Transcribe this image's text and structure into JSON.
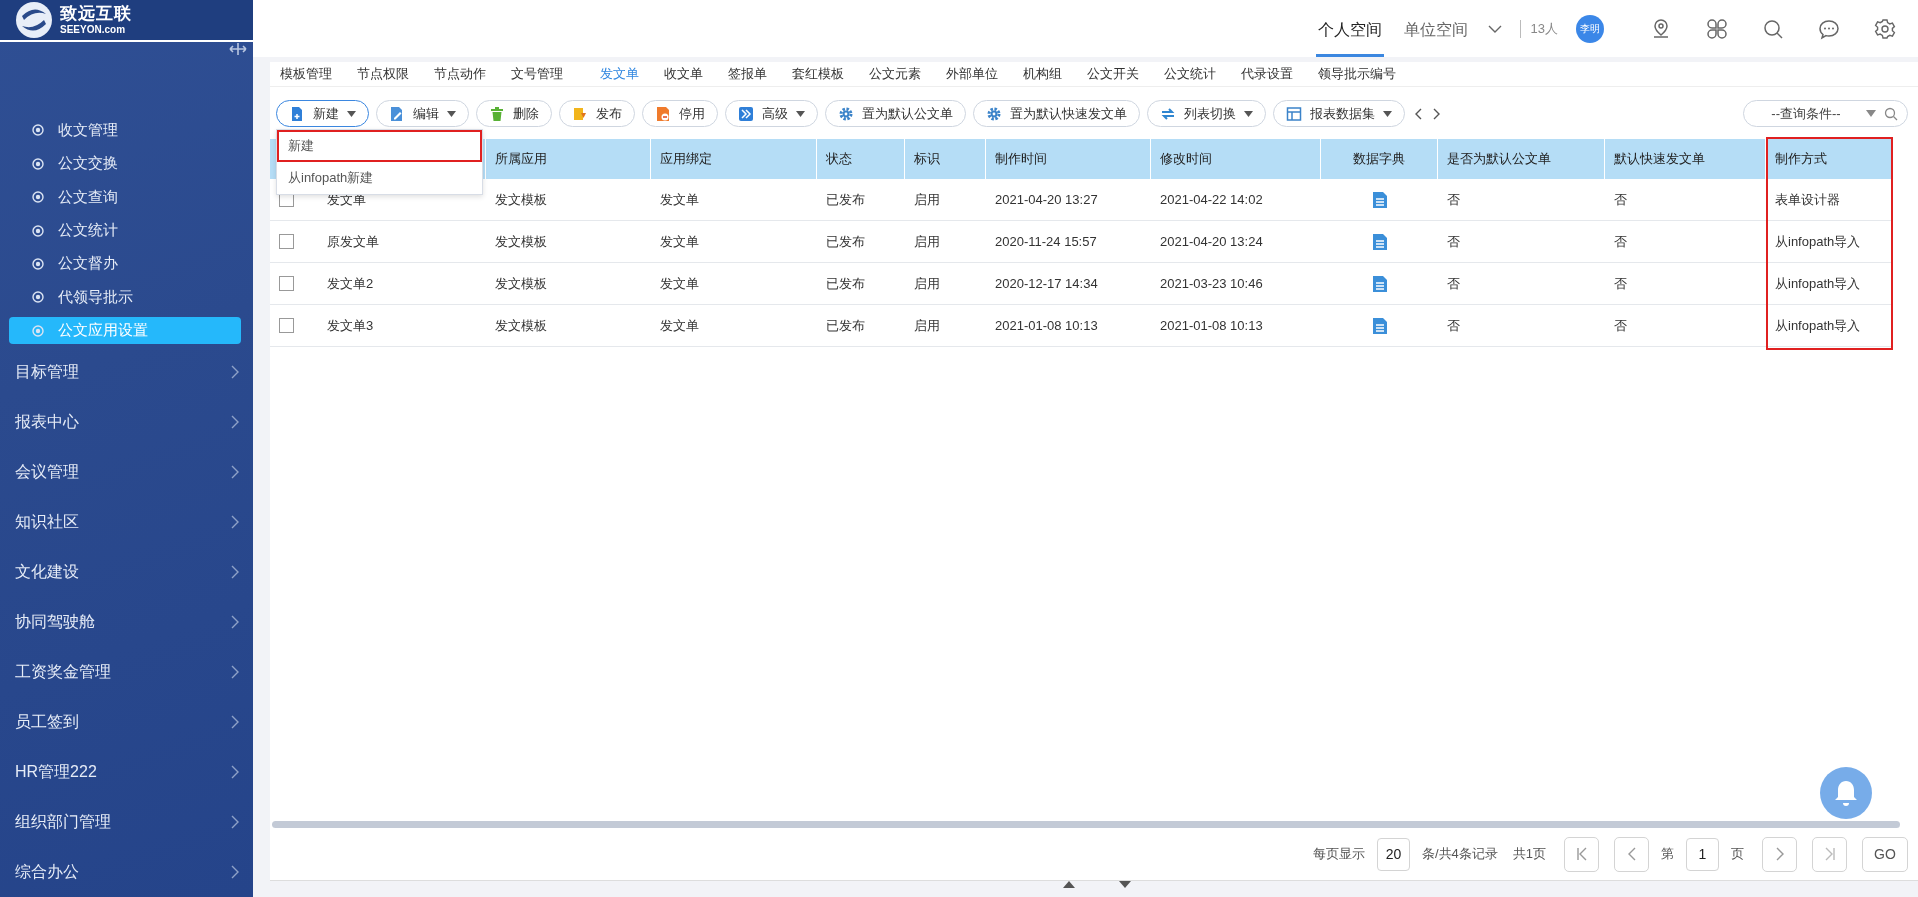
{
  "logo": {
    "name": "致远互联",
    "domain": "SEEYON.com"
  },
  "sidebar": {
    "sub_items": [
      {
        "label": "收文管理",
        "selected": false
      },
      {
        "label": "公文交换",
        "selected": false
      },
      {
        "label": "公文查询",
        "selected": false
      },
      {
        "label": "公文统计",
        "selected": false
      },
      {
        "label": "公文督办",
        "selected": false
      },
      {
        "label": "代领导批示",
        "selected": false
      },
      {
        "label": "公文应用设置",
        "selected": true
      }
    ],
    "items": [
      {
        "label": "目标管理"
      },
      {
        "label": "报表中心"
      },
      {
        "label": "会议管理"
      },
      {
        "label": "知识社区"
      },
      {
        "label": "文化建设"
      },
      {
        "label": "协同驾驶舱"
      },
      {
        "label": "工资奖金管理"
      },
      {
        "label": "员工签到"
      },
      {
        "label": "HR管理222"
      },
      {
        "label": "组织部门管理"
      },
      {
        "label": "综合办公"
      }
    ]
  },
  "top_bar": {
    "spaces": [
      {
        "label": "个人空间",
        "selected": true
      },
      {
        "label": "单位空间",
        "selected": false
      }
    ],
    "online": "13人",
    "avatar": "李明"
  },
  "tabs": [
    {
      "label": "模板管理",
      "selected": false
    },
    {
      "label": "节点权限",
      "selected": false
    },
    {
      "label": "节点动作",
      "selected": false
    },
    {
      "label": "文号管理",
      "selected": false
    },
    {
      "label": "发文单",
      "selected": true
    },
    {
      "label": "收文单",
      "selected": false
    },
    {
      "label": "签报单",
      "selected": false
    },
    {
      "label": "套红模板",
      "selected": false
    },
    {
      "label": "公文元素",
      "selected": false
    },
    {
      "label": "外部单位",
      "selected": false
    },
    {
      "label": "机构组",
      "selected": false
    },
    {
      "label": "公文开关",
      "selected": false
    },
    {
      "label": "公文统计",
      "selected": false
    },
    {
      "label": "代录设置",
      "selected": false
    },
    {
      "label": "领导批示编号",
      "selected": false
    }
  ],
  "toolbar": {
    "buttons": [
      {
        "label": "新建",
        "caret": true,
        "active": true
      },
      {
        "label": "编辑",
        "caret": true,
        "active": false
      },
      {
        "label": "删除",
        "caret": false,
        "active": false
      },
      {
        "label": "发布",
        "caret": false,
        "active": false
      },
      {
        "label": "停用",
        "caret": false,
        "active": false
      },
      {
        "label": "高级",
        "caret": true,
        "active": false
      },
      {
        "label": "置为默认公文单",
        "caret": false,
        "active": false
      },
      {
        "label": "置为默认快速发文单",
        "caret": false,
        "active": false
      },
      {
        "label": "列表切换",
        "caret": true,
        "active": false
      },
      {
        "label": "报表数据集",
        "caret": true,
        "active": false
      }
    ],
    "query": {
      "placeholder": "--查询条件--"
    }
  },
  "new_menu": {
    "items": [
      {
        "label": "新建",
        "highlighted": true
      },
      {
        "label": "从infopath新建",
        "highlighted": false
      }
    ]
  },
  "table": {
    "columns": [
      {
        "kind": "text"
      },
      {
        "kind": "text",
        "label": "所属应用"
      },
      {
        "kind": "text",
        "label": "应用绑定"
      },
      {
        "kind": "text",
        "label": "状态"
      },
      {
        "kind": "text",
        "label": "标识"
      },
      {
        "kind": "text",
        "label": "制作时间"
      },
      {
        "kind": "text",
        "label": "修改时间"
      },
      {
        "kind": "icon",
        "label": "数据字典"
      },
      {
        "kind": "text",
        "label": "是否为默认公文单"
      },
      {
        "kind": "text",
        "label": "默认快速发文单"
      },
      {
        "kind": "text",
        "label": "制作方式",
        "highlighted": true
      }
    ],
    "rows": [
      {
        "checked": false,
        "cells": [
          "发文单",
          "发文模板",
          "发文单",
          "已发布",
          "启用",
          "2021-04-20 13:27",
          "2021-04-22 14:02",
          {
            "kind": "icon"
          },
          "否",
          "否",
          "表单设计器"
        ]
      },
      {
        "checked": false,
        "cells": [
          "原发文单",
          "发文模板",
          "发文单",
          "已发布",
          "启用",
          "2020-11-24 15:57",
          "2021-04-20 13:24",
          {
            "kind": "icon"
          },
          "否",
          "否",
          "从infopath导入"
        ]
      },
      {
        "checked": false,
        "cells": [
          "发文单2",
          "发文模板",
          "发文单",
          "已发布",
          "启用",
          "2020-12-17 14:34",
          "2021-03-23 10:46",
          {
            "kind": "icon"
          },
          "否",
          "否",
          "从infopath导入"
        ]
      },
      {
        "checked": false,
        "cells": [
          "发文单3",
          "发文模板",
          "发文单",
          "已发布",
          "启用",
          "2021-01-08 10:13",
          "2021-01-08 10:13",
          {
            "kind": "icon"
          },
          "否",
          "否",
          "从infopath导入"
        ]
      }
    ]
  },
  "pagination": {
    "per_page_label": "每页显示",
    "page_size": "20",
    "summary": "条/共4条记录",
    "pages": "共1页",
    "page_prefix": "第",
    "page": "1",
    "page_suffix": "页",
    "go": "GO"
  }
}
